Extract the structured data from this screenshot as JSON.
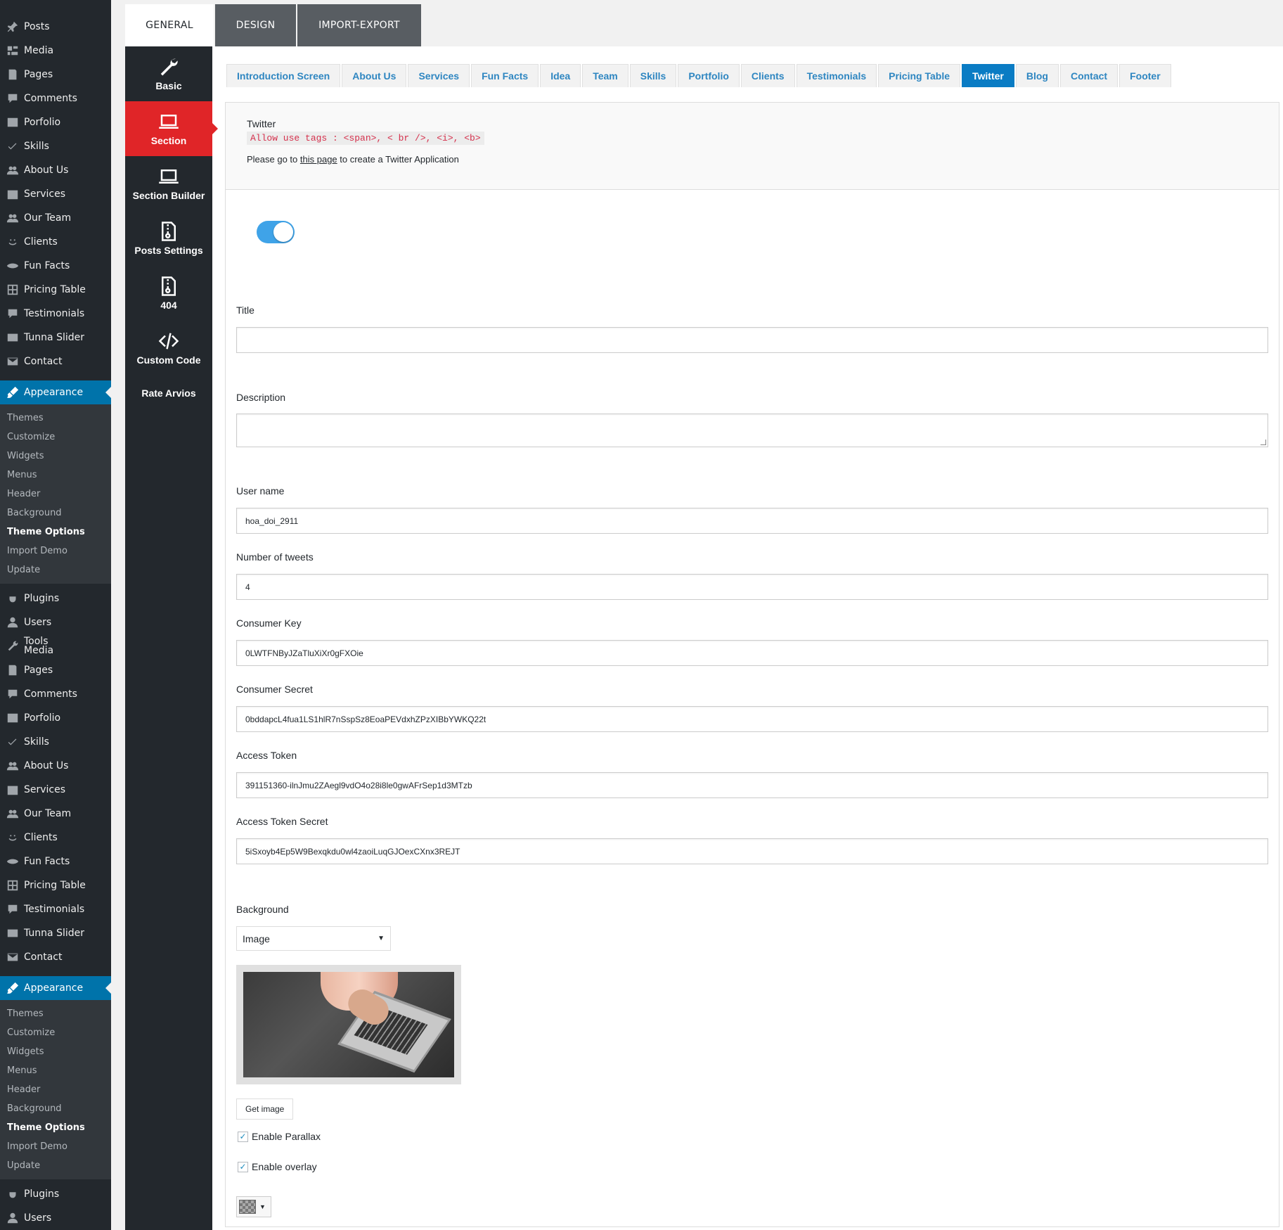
{
  "wp_menu": {
    "group_a": [
      "Posts",
      "Media",
      "Pages",
      "Comments",
      "Porfolio",
      "Skills",
      "About Us",
      "Services",
      "Our Team",
      "Clients",
      "Fun Facts",
      "Pricing Table",
      "Testimonials",
      "Tunna Slider",
      "Contact"
    ],
    "appearance_label": "Appearance",
    "appearance_sub": [
      "Themes",
      "Customize",
      "Widgets",
      "Menus",
      "Header",
      "Background",
      "Theme Options",
      "Import Demo",
      "Update"
    ],
    "after_sub": [
      "Plugins",
      "Users"
    ],
    "tools_label": "Tools",
    "group_b": [
      "Media",
      "Pages",
      "Comments",
      "Porfolio",
      "Skills",
      "About Us",
      "Services",
      "Our Team",
      "Clients",
      "Fun Facts",
      "Pricing Table",
      "Testimonials",
      "Tunna Slider",
      "Contact"
    ],
    "appearance_label_2": "Appearance",
    "appearance_sub_2": [
      "Themes",
      "Customize",
      "Widgets",
      "Menus",
      "Header",
      "Background",
      "Theme Options",
      "Import Demo",
      "Update"
    ],
    "after_sub_2": [
      "Plugins",
      "Users"
    ]
  },
  "top_tabs": [
    {
      "label": "GENERAL",
      "active": true
    },
    {
      "label": "DESIGN",
      "active": false
    },
    {
      "label": "IMPORT-EXPORT",
      "active": false
    }
  ],
  "option_nav": [
    {
      "label": "Basic",
      "icon": "wrench-icon"
    },
    {
      "label": "Section",
      "icon": "laptop-icon",
      "active": true
    },
    {
      "label": "Section Builder",
      "icon": "laptop-icon"
    },
    {
      "label": "Posts Settings",
      "icon": "file-zip-icon"
    },
    {
      "label": "404",
      "icon": "file-zip-icon"
    },
    {
      "label": "Custom Code",
      "icon": "code-icon"
    },
    {
      "label": "Rate Arvios",
      "icon": ""
    }
  ],
  "sub_tabs": [
    "Introduction Screen",
    "About Us",
    "Services",
    "Fun Facts",
    "Idea",
    "Team",
    "Skills",
    "Portfolio",
    "Clients",
    "Testimonials",
    "Pricing Table",
    "Twitter",
    "Blog",
    "Contact",
    "Footer"
  ],
  "sub_tab_active": "Twitter",
  "section": {
    "title": "Twitter",
    "allowed_tags": "Allow use tags : <span>, < br />, <i>, <b>",
    "note_before": "Please go to ",
    "note_link": "this page",
    "note_after": " to create a Twitter Application"
  },
  "toggle_on": true,
  "fields": {
    "title_label": "Title",
    "title_value": "",
    "description_label": "Description",
    "description_value": "",
    "username_label": "User name",
    "username_value": "hoa_doi_2911",
    "tweets_label": "Number of tweets",
    "tweets_value": "4",
    "consumer_key_label": "Consumer Key",
    "consumer_key_value": "0LWTFNByJZaTluXiXr0gFXOie",
    "consumer_secret_label": "Consumer Secret",
    "consumer_secret_value": "0bddapcL4fua1LS1hlR7nSspSz8EoaPEVdxhZPzXIBbYWKQ22t",
    "access_token_label": "Access Token",
    "access_token_value": "391151360-ilnJmu2ZAegl9vdO4o28i8le0gwAFrSep1d3MTzb",
    "access_secret_label": "Access Token Secret",
    "access_secret_value": "5iSxoyb4Ep5W9Bexqkdu0wl4zaoiLuqGJOexCXnx3REJT"
  },
  "background": {
    "label": "Background",
    "selected": "Image",
    "get_image": "Get image",
    "parallax_label": "Enable Parallax",
    "parallax_checked": true,
    "overlay_label": "Enable overlay",
    "overlay_checked": true
  },
  "colors": {
    "wp_sidebar": "#23282d",
    "wp_active": "#0073aa",
    "section_active": "#e02528",
    "tab_active": "#0a7cc4",
    "tab_text": "#2e86c1",
    "toggle": "#3fa3e8"
  }
}
